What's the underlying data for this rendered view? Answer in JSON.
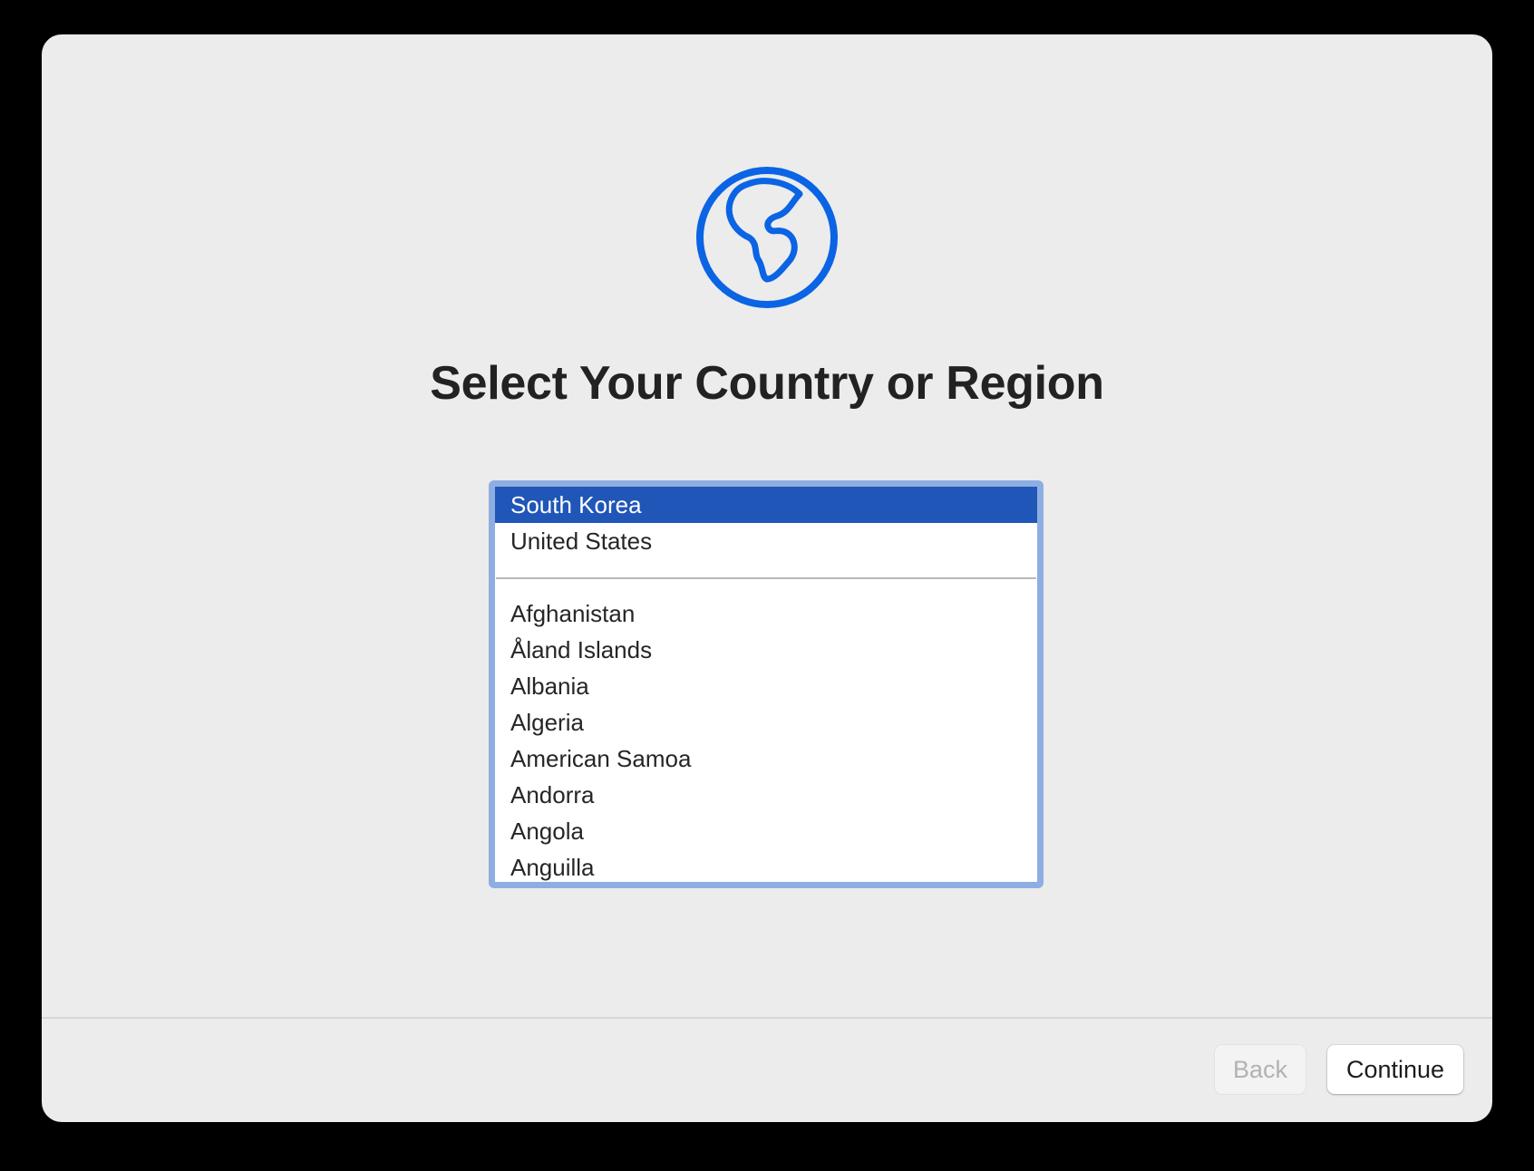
{
  "title": "Select Your Country or Region",
  "icon": "globe-icon",
  "accent_color": "#0a64e4",
  "selection_color": "#1f56b8",
  "list": {
    "top_items": [
      {
        "label": "South Korea",
        "selected": true
      },
      {
        "label": "United States",
        "selected": false
      }
    ],
    "items": [
      {
        "label": "Afghanistan"
      },
      {
        "label": "Åland Islands"
      },
      {
        "label": "Albania"
      },
      {
        "label": "Algeria"
      },
      {
        "label": "American Samoa"
      },
      {
        "label": "Andorra"
      },
      {
        "label": "Angola"
      },
      {
        "label": "Anguilla"
      }
    ]
  },
  "footer": {
    "back_label": "Back",
    "continue_label": "Continue"
  }
}
